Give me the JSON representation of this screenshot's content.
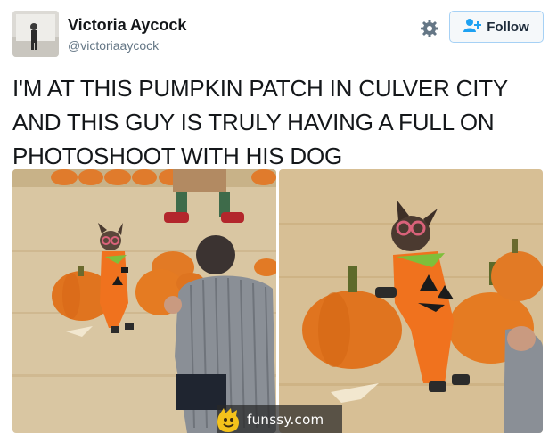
{
  "user": {
    "display_name": "Victoria Aycock",
    "handle": "@victoriaaycock"
  },
  "actions": {
    "settings_icon": "gear-icon",
    "follow_icon": "add-user-icon",
    "follow_label": "Follow",
    "accent_color": "#1da1f2"
  },
  "tweet": {
    "lines": [
      "I'M AT THIS PUMPKIN PATCH IN CULVER CITY",
      "AND THIS GUY IS TRULY HAVING A FULL ON",
      "PHOTOSHOOT WITH HIS DOG"
    ]
  },
  "media": {
    "photos": [
      "photo-left",
      "photo-right"
    ]
  },
  "watermark": {
    "text": "funssy.com"
  }
}
